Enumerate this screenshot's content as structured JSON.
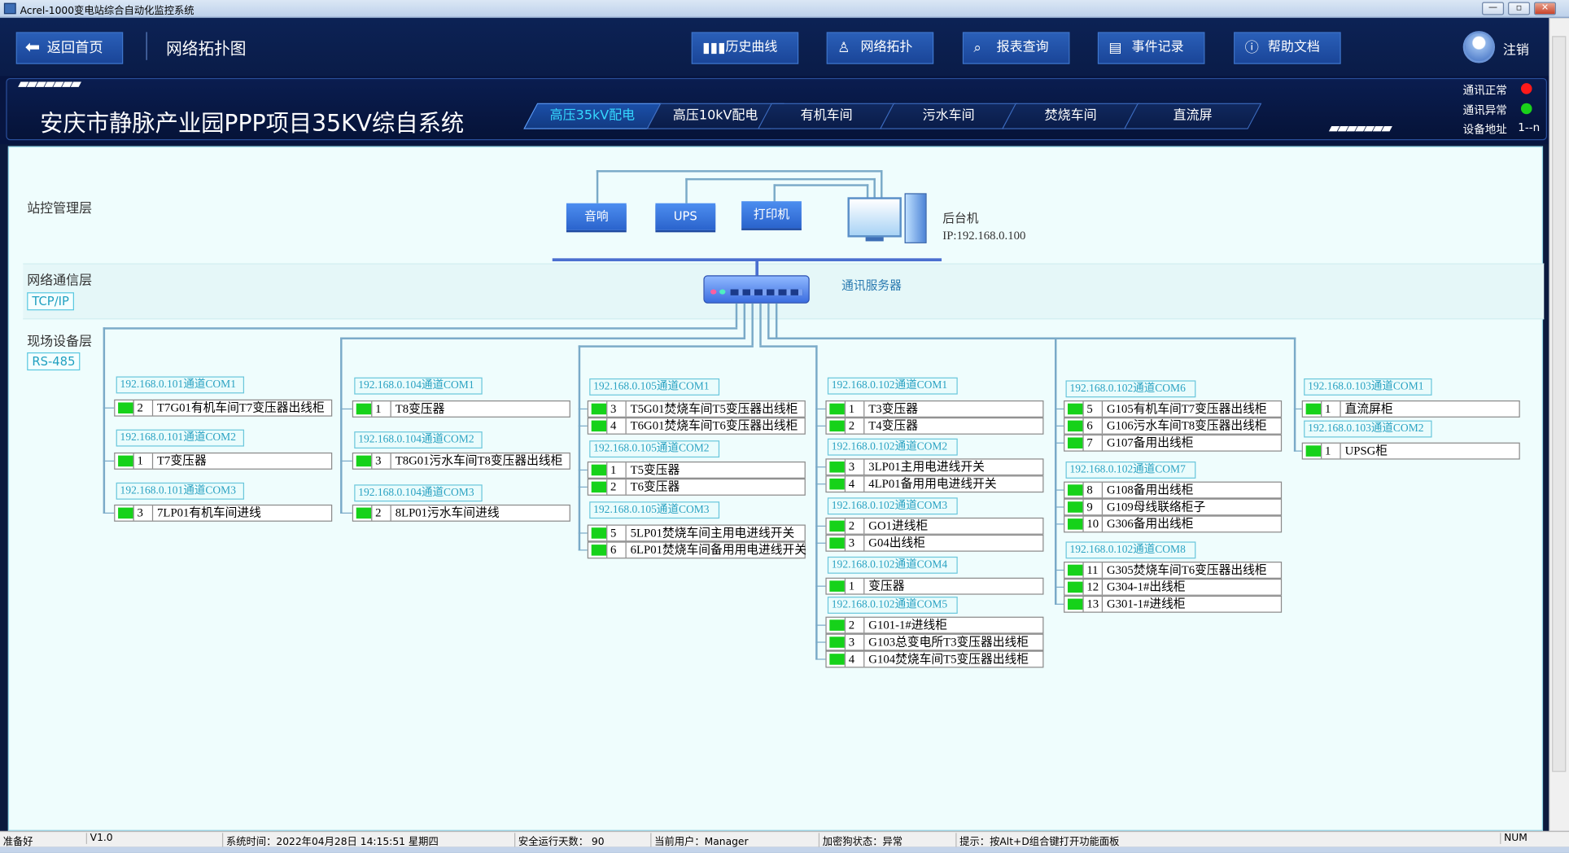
{
  "window": {
    "title": "Acrel-1000变电站综合自动化监控系统",
    "min": "—",
    "max": "▫",
    "close": "✕"
  },
  "header": {
    "back": "返回首页",
    "page_title": "网络拓扑图",
    "nav": [
      "历史曲线",
      "网络拓扑",
      "报表查询",
      "事件记录",
      "帮助文档"
    ],
    "logout": "注销"
  },
  "banner": {
    "system_name": "安庆市静脉产业园PPP项目35KV综自系统",
    "tabs": [
      "高压35kV配电",
      "高压10kV配电",
      "有机车间",
      "污水车间",
      "焚烧车间",
      "直流屏"
    ],
    "active_tab": 0,
    "status": [
      {
        "label": "通讯正常",
        "color": "#ff1a1a"
      },
      {
        "label": "通讯异常",
        "color": "#1ad21a"
      },
      {
        "label": "设备地址",
        "value": "1--n"
      }
    ]
  },
  "topology": {
    "layers": {
      "station": "站控管理层",
      "network": "网络通信层",
      "network_proto": "TCP/IP",
      "field": "现场设备层",
      "field_proto": "RS-485"
    },
    "devices": [
      "音响",
      "UPS",
      "打印机"
    ],
    "host": {
      "name": "后台机",
      "ip": "IP:192.168.0.100"
    },
    "server": "通讯服务器",
    "columns": [
      {
        "groups": [
          {
            "title": "192.168.0.101通道COM1",
            "rows": [
              {
                "n": "2",
                "name": "T7G01有机车间T7变压器出线柜"
              }
            ]
          },
          {
            "title": "192.168.0.101通道COM2",
            "rows": [
              {
                "n": "1",
                "name": "T7变压器"
              }
            ]
          },
          {
            "title": "192.168.0.101通道COM3",
            "rows": [
              {
                "n": "3",
                "name": "7LP01有机车间进线"
              }
            ]
          }
        ]
      },
      {
        "groups": [
          {
            "title": "192.168.0.104通道COM1",
            "rows": [
              {
                "n": "1",
                "name": "T8变压器"
              }
            ]
          },
          {
            "title": "192.168.0.104通道COM2",
            "rows": [
              {
                "n": "3",
                "name": "T8G01污水车间T8变压器出线柜"
              }
            ]
          },
          {
            "title": "192.168.0.104通道COM3",
            "rows": [
              {
                "n": "2",
                "name": "8LP01污水车间进线"
              }
            ]
          }
        ]
      },
      {
        "groups": [
          {
            "title": "192.168.0.105通道COM1",
            "rows": [
              {
                "n": "3",
                "name": "T5G01焚烧车间T5变压器出线柜"
              },
              {
                "n": "4",
                "name": "T6G01焚烧车间T6变压器出线柜"
              }
            ]
          },
          {
            "title": "192.168.0.105通道COM2",
            "rows": [
              {
                "n": "1",
                "name": "T5变压器"
              },
              {
                "n": "2",
                "name": "T6变压器"
              }
            ]
          },
          {
            "title": "192.168.0.105通道COM3",
            "rows": [
              {
                "n": "5",
                "name": "5LP01焚烧车间主用电进线开关"
              },
              {
                "n": "6",
                "name": "6LP01焚烧车间备用用电进线开关"
              }
            ]
          }
        ]
      },
      {
        "groups": [
          {
            "title": "192.168.0.102通道COM1",
            "rows": [
              {
                "n": "1",
                "name": "T3变压器"
              },
              {
                "n": "2",
                "name": "T4变压器"
              }
            ]
          },
          {
            "title": "192.168.0.102通道COM2",
            "rows": [
              {
                "n": "3",
                "name": "3LP01主用电进线开关"
              },
              {
                "n": "4",
                "name": "4LP01备用用电进线开关"
              }
            ]
          },
          {
            "title": "192.168.0.102通道COM3",
            "rows": [
              {
                "n": "2",
                "name": "GO1进线柜"
              },
              {
                "n": "3",
                "name": "G04出线柜"
              }
            ]
          },
          {
            "title": "192.168.0.102通道COM4",
            "rows": [
              {
                "n": "1",
                "name": "变压器"
              }
            ]
          },
          {
            "title": "192.168.0.102通道COM5",
            "rows": [
              {
                "n": "2",
                "name": "G101-1#进线柜"
              },
              {
                "n": "3",
                "name": "G103总变电所T3变压器出线柜"
              },
              {
                "n": "4",
                "name": "G104焚烧车间T5变压器出线柜"
              }
            ]
          }
        ]
      },
      {
        "groups": [
          {
            "title": "192.168.0.102通道COM6",
            "rows": [
              {
                "n": "5",
                "name": "G105有机车间T7变压器出线柜"
              },
              {
                "n": "6",
                "name": "G106污水车间T8变压器出线柜"
              },
              {
                "n": "7",
                "name": "G107备用出线柜"
              }
            ]
          },
          {
            "title": "192.168.0.102通道COM7",
            "rows": [
              {
                "n": "8",
                "name": "G108备用出线柜"
              },
              {
                "n": "9",
                "name": "G109母线联络柜子"
              },
              {
                "n": "10",
                "name": "G306备用出线柜"
              }
            ]
          },
          {
            "title": "192.168.0.102通道COM8",
            "rows": [
              {
                "n": "11",
                "name": "G305焚烧车间T6变压器出线柜"
              },
              {
                "n": "12",
                "name": "G304-1#出线柜"
              },
              {
                "n": "13",
                "name": "G301-1#进线柜"
              }
            ]
          }
        ]
      },
      {
        "groups": [
          {
            "title": "192.168.0.103通道COM1",
            "rows": [
              {
                "n": "1",
                "name": "直流屏柜"
              }
            ]
          },
          {
            "title": "192.168.0.103通道COM2",
            "rows": [
              {
                "n": "1",
                "name": "UPSG柜"
              }
            ]
          }
        ]
      }
    ]
  },
  "statusbar": {
    "ready": "准备好",
    "version": "V1.0",
    "time": "系统时间：2022年04月28日   14:15:51   星期四",
    "days": "安全运行天数：  90",
    "user": "当前用户：Manager",
    "dongle": "加密狗状态：异常",
    "hint": "提示：按Alt+D组合键打开功能面板",
    "num": "NUM"
  }
}
